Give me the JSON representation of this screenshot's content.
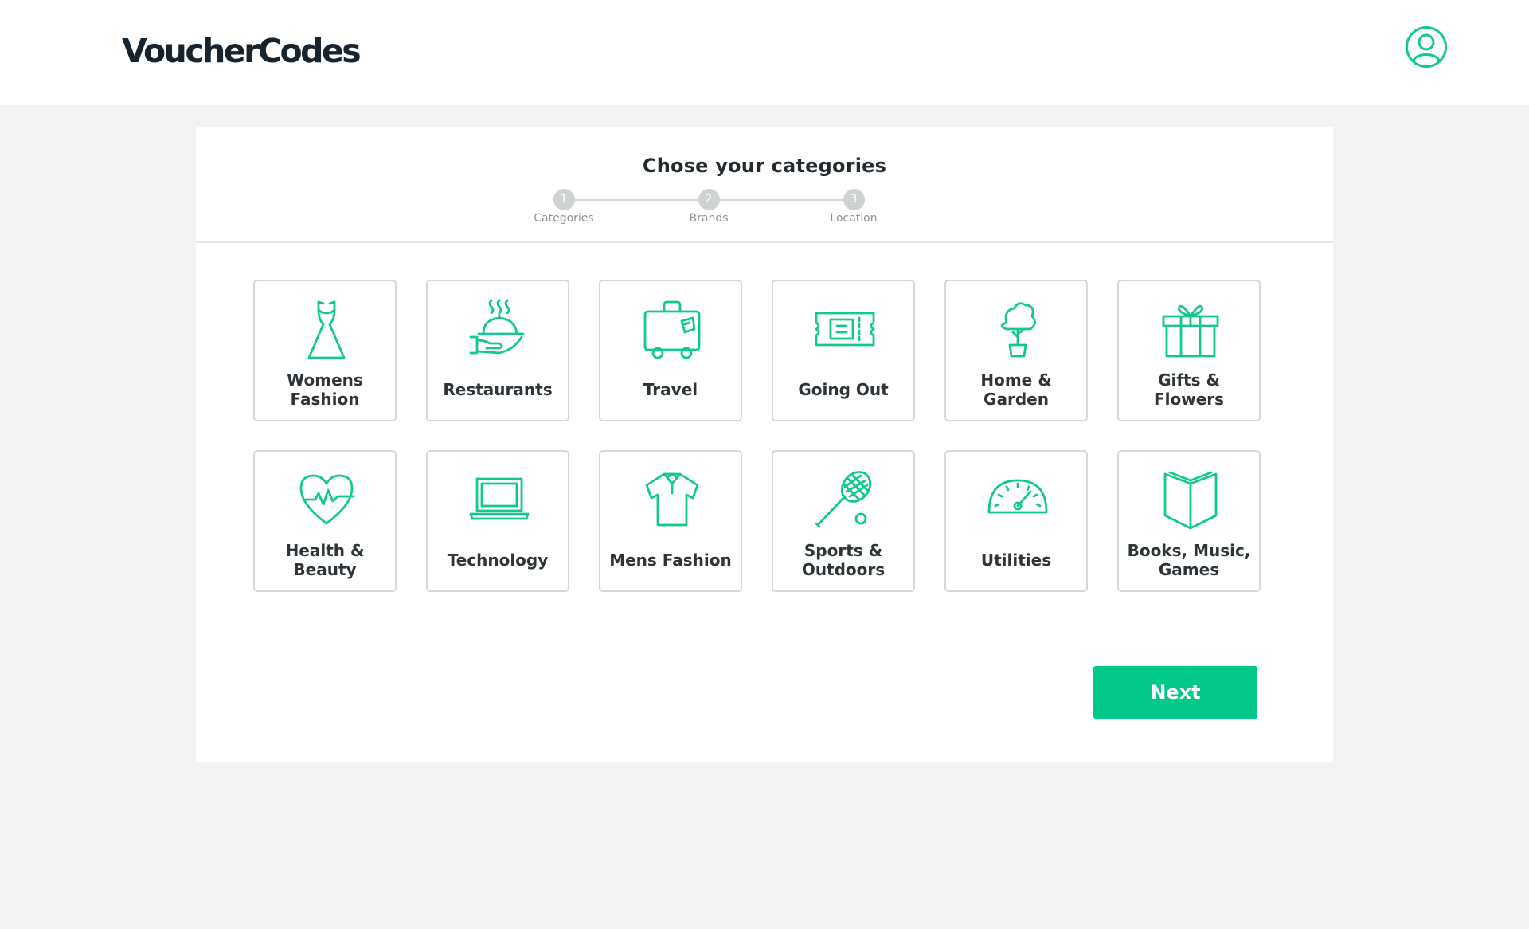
{
  "header": {
    "logo_text": "VoucherCodes",
    "account_icon": "user-circle-icon"
  },
  "page": {
    "title": "Chose your categories"
  },
  "steps": [
    {
      "number": "1",
      "label": "Categories"
    },
    {
      "number": "2",
      "label": "Brands"
    },
    {
      "number": "3",
      "label": "Location"
    }
  ],
  "categories": [
    {
      "label": "Womens Fashion",
      "icon": "dress-icon"
    },
    {
      "label": "Restaurants",
      "icon": "cloche-icon"
    },
    {
      "label": "Travel",
      "icon": "suitcase-icon"
    },
    {
      "label": "Going Out",
      "icon": "ticket-icon"
    },
    {
      "label": "Home & Garden",
      "icon": "potted-tree-icon"
    },
    {
      "label": "Gifts & Flowers",
      "icon": "gift-icon"
    },
    {
      "label": "Health & Beauty",
      "icon": "heartbeat-icon"
    },
    {
      "label": "Technology",
      "icon": "laptop-icon"
    },
    {
      "label": "Mens Fashion",
      "icon": "polo-shirt-icon"
    },
    {
      "label": "Sports & Outdoors",
      "icon": "tennis-racket-icon"
    },
    {
      "label": "Utilities",
      "icon": "gauge-icon"
    },
    {
      "label": "Books, Music, Games",
      "icon": "book-icon"
    }
  ],
  "actions": {
    "next_label": "Next"
  },
  "colors": {
    "accent": "#00c98a",
    "icon_stroke": "#11c98b",
    "background": "#f2f3f2",
    "text": "#222a2e"
  }
}
